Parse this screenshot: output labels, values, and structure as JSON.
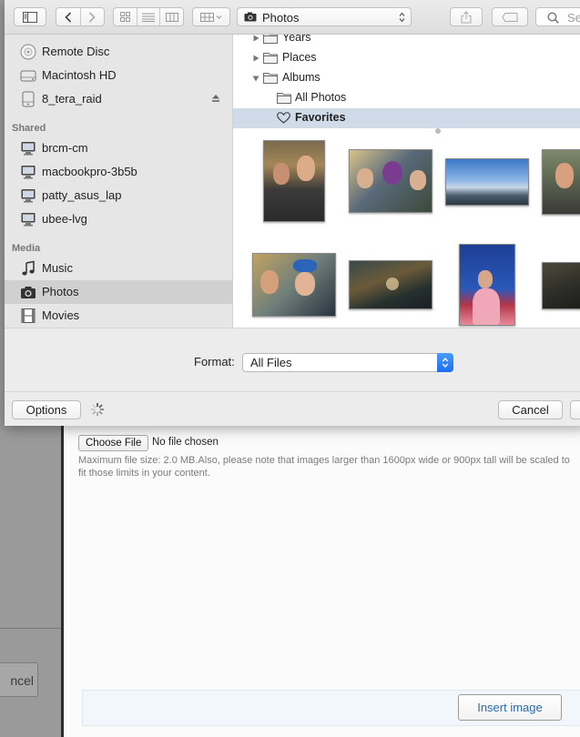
{
  "toolbar": {
    "location_popup": "Photos",
    "search_placeholder": "Se"
  },
  "sidebar": {
    "devices": [
      {
        "label": "Remote Disc",
        "icon": "disc-icon"
      },
      {
        "label": "Macintosh HD",
        "icon": "hard-drive-icon"
      },
      {
        "label": "8_tera_raid",
        "icon": "external-drive-icon"
      }
    ],
    "shared_heading": "Shared",
    "shared": [
      {
        "label": "brcm-cm",
        "icon": "computer-icon"
      },
      {
        "label": "macbookpro-3b5b",
        "icon": "computer-icon"
      },
      {
        "label": "patty_asus_lap",
        "icon": "computer-icon"
      },
      {
        "label": "ubee-lvg",
        "icon": "computer-icon"
      }
    ],
    "media_heading": "Media",
    "media": [
      {
        "label": "Music",
        "icon": "music-note-icon"
      },
      {
        "label": "Photos",
        "icon": "camera-icon",
        "selected": true
      },
      {
        "label": "Movies",
        "icon": "film-icon"
      }
    ]
  },
  "tree": {
    "years": "Years",
    "places": "Places",
    "albums": "Albums",
    "all_photos": "All Photos",
    "favorites": "Favorites"
  },
  "format": {
    "label": "Format:",
    "value": "All Files"
  },
  "buttons": {
    "options": "Options",
    "cancel": "Cancel"
  },
  "page": {
    "choose_file": "Choose File",
    "no_file": "No file chosen",
    "help": "Maximum file size: 2.0 MB.Also, please note that images larger than 1600px wide or 900px tall will be scaled to fit those limits in your content.",
    "insert_image": "Insert image",
    "bg_cancel": "ncel"
  }
}
